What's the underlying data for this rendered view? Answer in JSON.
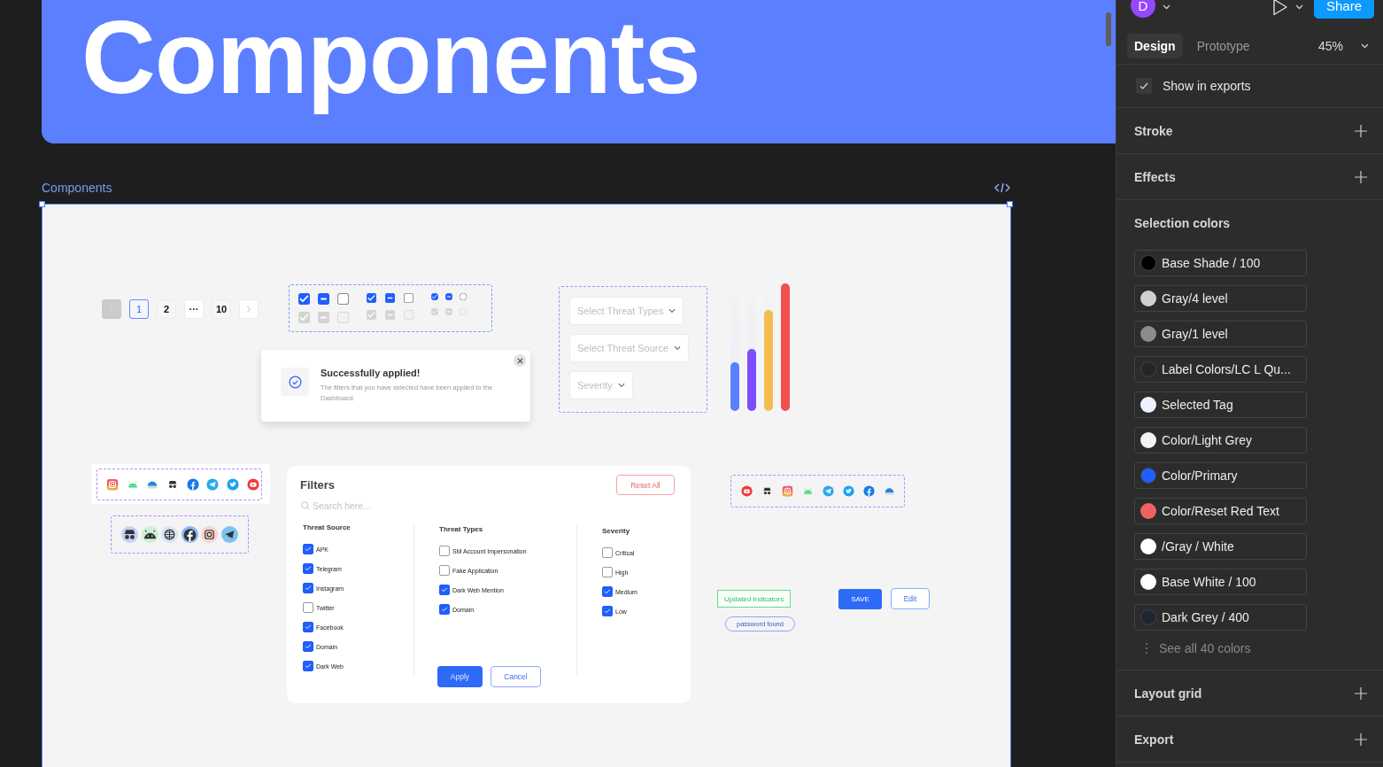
{
  "banner": {
    "title": "Components"
  },
  "frame": {
    "label": "Components"
  },
  "pagination": {
    "prev_disabled": true,
    "next_disabled": false,
    "pages": [
      {
        "label": "1",
        "selected": true
      },
      {
        "label": "2",
        "selected": false
      },
      {
        "label": "···",
        "selected": false
      },
      {
        "label": "10",
        "selected": false
      }
    ]
  },
  "checkbox_sets": [
    {
      "kind": "large",
      "items": [
        {
          "checked": true,
          "indeterminate": false,
          "disabled": false
        },
        {
          "checked": false,
          "indeterminate": true,
          "disabled": false
        },
        {
          "checked": false,
          "indeterminate": false,
          "disabled": false
        },
        {
          "checked": true,
          "indeterminate": false,
          "disabled": true
        },
        {
          "checked": false,
          "indeterminate": true,
          "disabled": true
        },
        {
          "checked": false,
          "indeterminate": false,
          "disabled": true
        }
      ]
    },
    {
      "kind": "medium",
      "items": [
        {
          "checked": true,
          "indeterminate": false,
          "disabled": false
        },
        {
          "checked": false,
          "indeterminate": true,
          "disabled": false
        },
        {
          "checked": false,
          "indeterminate": false,
          "disabled": false
        },
        {
          "checked": true,
          "indeterminate": false,
          "disabled": true
        },
        {
          "checked": false,
          "indeterminate": true,
          "disabled": true
        },
        {
          "checked": false,
          "indeterminate": false,
          "disabled": true
        }
      ]
    },
    {
      "kind": "small",
      "items": [
        {
          "checked": true,
          "indeterminate": false,
          "disabled": false
        },
        {
          "checked": false,
          "indeterminate": true,
          "disabled": false
        },
        {
          "checked": false,
          "indeterminate": false,
          "disabled": false
        },
        {
          "checked": true,
          "indeterminate": false,
          "disabled": true
        },
        {
          "checked": false,
          "indeterminate": true,
          "disabled": true
        },
        {
          "checked": false,
          "indeterminate": false,
          "disabled": true
        }
      ]
    }
  ],
  "toast": {
    "title": "Successfully applied!",
    "message": "The filters that you have selected have been applied to the Dashboard."
  },
  "dropdowns": [
    {
      "placeholder": "Select Threat Types"
    },
    {
      "placeholder": "Select Threat Source"
    },
    {
      "placeholder": "Severity"
    }
  ],
  "bars": [
    {
      "level": 0.3,
      "color": "#5b7fff"
    },
    {
      "level": 0.38,
      "color": "#7d4cff"
    },
    {
      "level": 0.62,
      "color": "#f5bd4f"
    },
    {
      "level": 0.78,
      "color": "#f04f4f"
    }
  ],
  "filters": {
    "title": "Filters",
    "reset": "Reset All",
    "search_placeholder": "Search here...",
    "groups": [
      {
        "heading": "Threat Source",
        "options": [
          {
            "label": "APK",
            "checked": true
          },
          {
            "label": "Telegram",
            "checked": true
          },
          {
            "label": "Instagram",
            "checked": true
          },
          {
            "label": "Twitter",
            "checked": false
          },
          {
            "label": "Facebook",
            "checked": true
          },
          {
            "label": "Domain",
            "checked": true
          },
          {
            "label": "Dark Web",
            "checked": true
          }
        ]
      },
      {
        "heading": "Threat Types",
        "options": [
          {
            "label": "SM Account Impersonation",
            "checked": false
          },
          {
            "label": "Fake Application",
            "checked": false
          },
          {
            "label": "Dark Web Mention",
            "checked": true
          },
          {
            "label": "Domain",
            "checked": true
          }
        ]
      },
      {
        "heading": "Severity",
        "options": [
          {
            "label": "Critical",
            "checked": false
          },
          {
            "label": "High",
            "checked": false
          },
          {
            "label": "Medium",
            "checked": true
          },
          {
            "label": "Low",
            "checked": true
          }
        ]
      }
    ],
    "apply": "Apply",
    "cancel": "Cancel"
  },
  "tags": [
    "Updated Indicators",
    "password found"
  ],
  "buttons": [
    "SAVE",
    "Edit"
  ],
  "panel": {
    "avatar": "D",
    "share": "Share",
    "tabs": [
      {
        "label": "Design",
        "selected": true
      },
      {
        "label": "Prototype",
        "selected": false
      }
    ],
    "zoom": "45%",
    "show_in_exports": {
      "label": "Show in exports",
      "checked": true
    },
    "sections": [
      "Stroke",
      "Effects"
    ],
    "selection_colors": {
      "title": "Selection colors",
      "colors": [
        {
          "name": "Base Shade / 100",
          "color": "#000000"
        },
        {
          "name": "Gray/4 level",
          "color": "#d0d0d0"
        },
        {
          "name": "Gray/1 level",
          "color": "#8c8c8c"
        },
        {
          "name": "Label Colors/LC L Qu...",
          "color": "#262626"
        },
        {
          "name": "Selected Tag",
          "color": "#eef2ff"
        },
        {
          "name": "Color/Light Grey",
          "color": "#f4f4f4"
        },
        {
          "name": "Color/Primary",
          "color": "#1f5eff"
        },
        {
          "name": "Color/Reset Red Text",
          "color": "#f06262"
        },
        {
          "name": "/Gray / White",
          "color": "#ffffff"
        },
        {
          "name": "Base White / 100",
          "color": "#fefefe"
        },
        {
          "name": "Dark Grey / 400",
          "color": "#1f2633"
        }
      ],
      "see_all": "See all 40 colors"
    },
    "bottom_sections": [
      "Layout grid",
      "Export"
    ]
  }
}
